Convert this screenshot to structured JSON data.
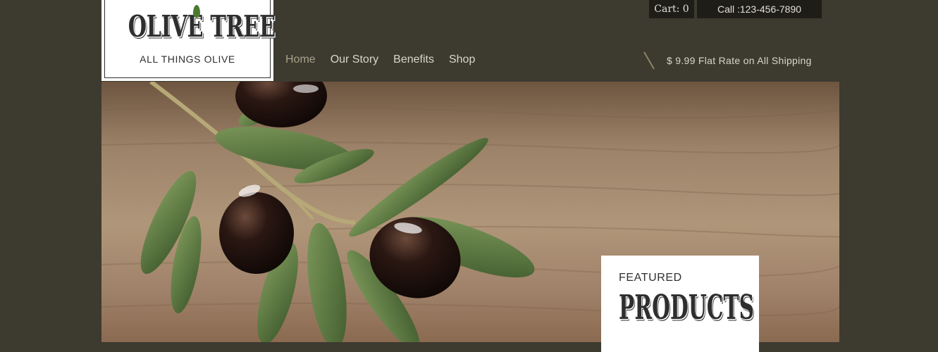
{
  "logo": {
    "title": "OLIVE TREE",
    "tagline": "ALL THINGS OLIVE"
  },
  "nav": {
    "items": [
      {
        "label": "Home",
        "active": true
      },
      {
        "label": "Our Story",
        "active": false
      },
      {
        "label": "Benefits",
        "active": false
      },
      {
        "label": "Shop",
        "active": false
      }
    ]
  },
  "header": {
    "cart_label": "Cart: 0",
    "phone_label": "Call :123-456-7890",
    "shipping_notice": "$ 9.99 Flat Rate on All Shipping"
  },
  "featured": {
    "small": "FEATURED",
    "big": "PRODUCTS"
  },
  "colors": {
    "background": "#3d3a30",
    "nav_text": "#d9d6cc",
    "nav_active": "#a7a28c",
    "dark_box": "#1f1d18",
    "leaf_accent": "#4b7a2e"
  },
  "icons": {
    "hero_image": "olive-branch-image",
    "divider": "slash-divider-icon"
  }
}
